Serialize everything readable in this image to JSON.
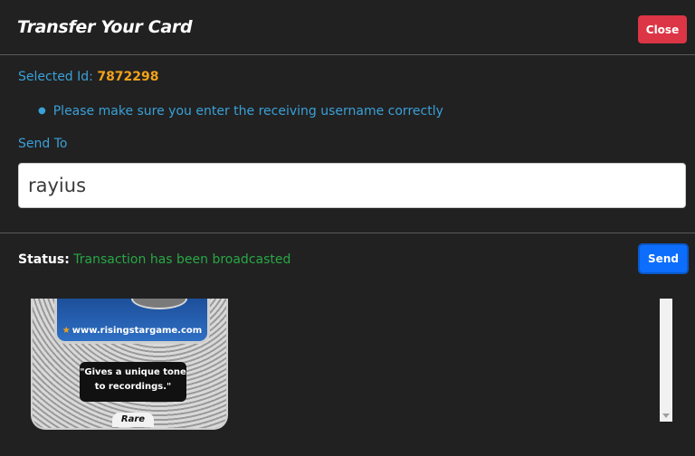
{
  "modal": {
    "title": "Transfer Your Card",
    "close_label": "Close"
  },
  "selected": {
    "label": "Selected Id:",
    "id": "7872298"
  },
  "notice": {
    "text": "Please make sure you enter the receiving username correctly"
  },
  "send_to": {
    "label": "Send To",
    "value": "rayius"
  },
  "status": {
    "label": "Status:",
    "text": "Transaction has been broadcasted"
  },
  "send_label": "Send",
  "card": {
    "url": "www.risingstargame.com",
    "quote_line1": "\"Gives a unique tone",
    "quote_line2": "to recordings.\"",
    "rarity": "Rare"
  },
  "colors": {
    "background": "#212121",
    "accent_blue": "#3aa0d8",
    "id_orange": "#f2a21a",
    "status_green": "#28a745",
    "close_red": "#dc3545",
    "send_blue": "#0d6efd"
  }
}
